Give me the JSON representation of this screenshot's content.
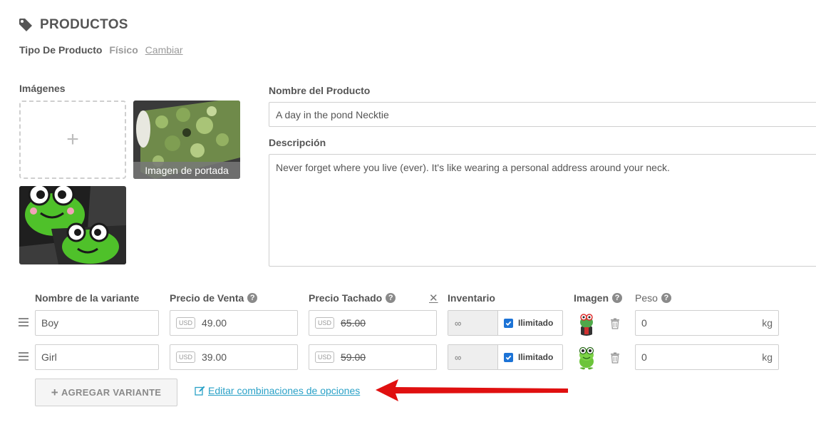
{
  "header": {
    "title": "PRODUCTOS",
    "type_label": "Tipo De Producto",
    "type_value": "Físico",
    "type_change": "Cambiar"
  },
  "images": {
    "heading": "Imágenes",
    "add_symbol": "+",
    "cover_label": "Imagen de portada"
  },
  "product": {
    "name_label": "Nombre del Producto",
    "name_value": "A day in the pond Necktie",
    "desc_label": "Descripción",
    "desc_value": "Never forget where you live (ever). It's like wearing a personal address around your neck."
  },
  "variants": {
    "headers": {
      "name": "Nombre de la variante",
      "price": "Precio de Venta",
      "compare": "Precio Tachado",
      "inventory": "Inventario",
      "image": "Imagen",
      "weight": "Peso"
    },
    "currency_badge": "USD",
    "clear_symbol": "✕",
    "rows": [
      {
        "name": "Boy",
        "price": "49.00",
        "compare": "65.00",
        "inventory": "∞",
        "unlimited_label": "Ilimitado",
        "weight": "0",
        "weight_unit": "kg"
      },
      {
        "name": "Girl",
        "price": "39.00",
        "compare": "59.00",
        "inventory": "∞",
        "unlimited_label": "Ilimitado",
        "weight": "0",
        "weight_unit": "kg"
      }
    ],
    "add_button": "AGREGAR VARIANTE",
    "edit_link": "Editar combinaciones de opciones"
  },
  "colors": {
    "accent_link": "#2aa1c7",
    "checkbox": "#1c73d6",
    "arrow": "#e01010"
  }
}
